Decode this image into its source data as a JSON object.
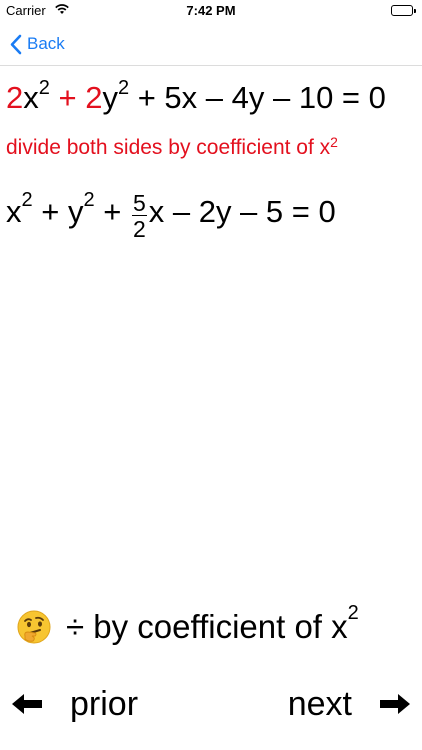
{
  "status": {
    "carrier": "Carrier",
    "time": "7:42 PM"
  },
  "nav": {
    "back_label": "Back"
  },
  "equation1": {
    "c1": "2",
    "x": "x",
    "e1": "2",
    "plus1": " + ",
    "c2": "2",
    "y": "y",
    "e2": "2",
    "rest": " + 5x – 4y – 10 = 0"
  },
  "note": {
    "text": "divide both sides by coefficient of x",
    "exp": "2"
  },
  "equation2": {
    "x": "x",
    "e1": "2",
    "plus_y": " + y",
    "e2": "2",
    "plus": " + ",
    "frac_num": "5",
    "frac_den": "2",
    "rest": "x – 2y – 5 = 0"
  },
  "hint": {
    "text": "÷ by coefficient of x",
    "exp": "2",
    "icon": "thinking-face-icon"
  },
  "footer": {
    "prior_label": "prior",
    "next_label": "next"
  },
  "colors": {
    "accent": "#1a7cf4",
    "highlight": "#e3101e"
  }
}
